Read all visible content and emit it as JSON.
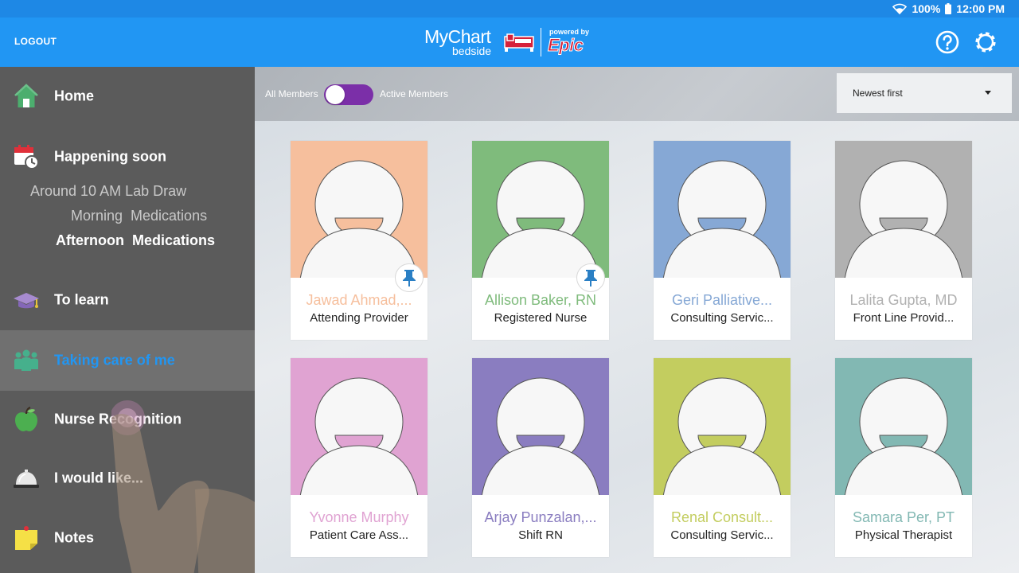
{
  "status_bar": {
    "battery": "100%",
    "time": "12:00 PM"
  },
  "header": {
    "logout_label": "LOGOUT",
    "logo_main": "MyChart",
    "logo_sub": "bedside",
    "powered_by": "powered by",
    "brand": "Epic"
  },
  "sidebar": {
    "items": [
      {
        "label": "Home",
        "icon": "house-icon"
      },
      {
        "label": "Happening soon",
        "icon": "calendar-clock-icon"
      },
      {
        "label": "To learn",
        "icon": "graduation-cap-icon"
      },
      {
        "label": "Taking care of me",
        "icon": "care-team-icon",
        "active": true
      },
      {
        "label": "Nurse Recognition",
        "icon": "apple-icon"
      },
      {
        "label": "I would like...",
        "icon": "service-bell-icon"
      },
      {
        "label": "Notes",
        "icon": "sticky-note-icon"
      }
    ],
    "happening_soon": [
      {
        "time": "Around 10 AM",
        "text": "Lab Draw"
      },
      {
        "time": "",
        "text": "Morning  Medications"
      },
      {
        "time": "",
        "text": "Afternoon  Medications",
        "current": true
      }
    ]
  },
  "filter": {
    "all_members": "All Members",
    "active_members": "Active Members",
    "sort_value": "Newest first"
  },
  "care_team": [
    {
      "name": "Jawad Ahmad,...",
      "role": "Attending Provider",
      "color": "#f6bf9d",
      "pinned": true
    },
    {
      "name": "Allison Baker, RN",
      "role": "Registered Nurse",
      "color": "#7fbb7c",
      "pinned": true
    },
    {
      "name": "Geri Palliative...",
      "role": "Consulting Servic...",
      "color": "#86a8d5",
      "pinned": false
    },
    {
      "name": "Lalita Gupta, MD",
      "role": "Front Line Provid...",
      "color": "#b1b1b1",
      "pinned": false
    },
    {
      "name": "Yvonne Murphy",
      "role": "Patient Care Ass...",
      "color": "#e0a3d2",
      "pinned": false
    },
    {
      "name": "Arjay Punzalan,...",
      "role": "Shift RN",
      "color": "#8a7dc0",
      "pinned": false
    },
    {
      "name": "Renal Consult...",
      "role": "Consulting Servic...",
      "color": "#c3cd5f",
      "pinned": false
    },
    {
      "name": "Samara Per, PT",
      "role": "Physical Therapist",
      "color": "#82b8b3",
      "pinned": false
    }
  ],
  "colors": {
    "header": "#2196f3",
    "status_bar": "#1e88e5",
    "sidebar": "#5b5b5b",
    "active_text": "#2196f3",
    "toggle": "#7b2fa8",
    "pin": "#2a7fc4"
  }
}
